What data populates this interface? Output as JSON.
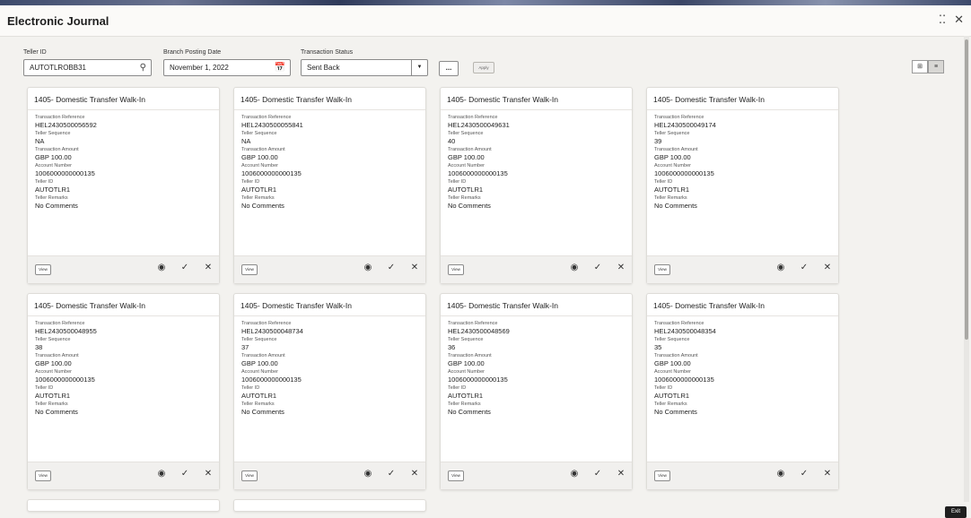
{
  "app": {
    "title": "Electronic Journal",
    "window_controls": {
      "restore_icon": "⁚⁚",
      "close_icon": "✕"
    },
    "exit_label": "Exit"
  },
  "filters": {
    "teller_id": {
      "label": "Teller ID",
      "value": "AUTOTLROBB31",
      "icon": "search-icon"
    },
    "branch_posting_date": {
      "label": "Branch Posting Date",
      "value": "November 1, 2022",
      "icon": "calendar-icon"
    },
    "transaction_status": {
      "label": "Transaction Status",
      "value": "Sent Back"
    },
    "more_label": "...",
    "apply_label": "Apply"
  },
  "view_toggle": {
    "grid_icon": "⊞",
    "list_icon": "≡"
  },
  "card_labels": {
    "reference": "Transaction Reference",
    "sequence": "Teller Sequence",
    "amount": "Transaction Amount",
    "account": "Account Number",
    "teller_id": "Teller ID",
    "remarks": "Teller Remarks",
    "view_button": "View"
  },
  "cards": [
    {
      "title": "1405- Domestic Transfer Walk-In",
      "reference": "HEL2430500056592",
      "sequence": "NA",
      "amount": "GBP 100.00",
      "account": "1006000000000135",
      "teller_id": "AUTOTLR1",
      "remarks": "No Comments"
    },
    {
      "title": "1405- Domestic Transfer Walk-In",
      "reference": "HEL2430500055841",
      "sequence": "NA",
      "amount": "GBP 100.00",
      "account": "1006000000000135",
      "teller_id": "AUTOTLR1",
      "remarks": "No Comments"
    },
    {
      "title": "1405- Domestic Transfer Walk-In",
      "reference": "HEL2430500049631",
      "sequence": "40",
      "amount": "GBP 100.00",
      "account": "1006000000000135",
      "teller_id": "AUTOTLR1",
      "remarks": "No Comments"
    },
    {
      "title": "1405- Domestic Transfer Walk-In",
      "reference": "HEL2430500049174",
      "sequence": "39",
      "amount": "GBP 100.00",
      "account": "1006000000000135",
      "teller_id": "AUTOTLR1",
      "remarks": "No Comments"
    },
    {
      "title": "1405- Domestic Transfer Walk-In",
      "reference": "HEL2430500048955",
      "sequence": "38",
      "amount": "GBP 100.00",
      "account": "1006000000000135",
      "teller_id": "AUTOTLR1",
      "remarks": "No Comments"
    },
    {
      "title": "1405- Domestic Transfer Walk-In",
      "reference": "HEL2430500048734",
      "sequence": "37",
      "amount": "GBP 100.00",
      "account": "1006000000000135",
      "teller_id": "AUTOTLR1",
      "remarks": "No Comments"
    },
    {
      "title": "1405- Domestic Transfer Walk-In",
      "reference": "HEL2430500048569",
      "sequence": "36",
      "amount": "GBP 100.00",
      "account": "1006000000000135",
      "teller_id": "AUTOTLR1",
      "remarks": "No Comments"
    },
    {
      "title": "1405- Domestic Transfer Walk-In",
      "reference": "HEL2430500048354",
      "sequence": "35",
      "amount": "GBP 100.00",
      "account": "1006000000000135",
      "teller_id": "AUTOTLR1",
      "remarks": "No Comments"
    }
  ],
  "card_actions": {
    "view_icon": "◉",
    "approve_icon": "✓",
    "reject_icon": "✕"
  }
}
